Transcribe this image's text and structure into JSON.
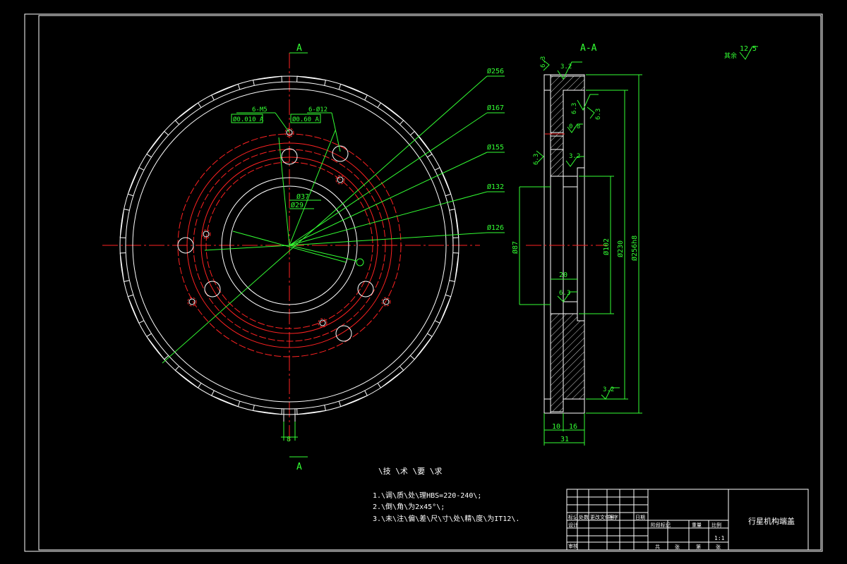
{
  "colors": {
    "background": "#000000",
    "outline": "#ffffff",
    "dimension": "#33ff33",
    "centerline": "#ff2222",
    "hidden": "#ff2222"
  },
  "drawing": {
    "section_marker_top": "A",
    "section_marker_bottom": "A",
    "section_title": "A-A",
    "hole_callout_1": "6-M5",
    "hole_callout_2": "6-Ø12",
    "tolerance_frame_1": "Ø0.010 A",
    "tolerance_frame_2": "Ø0.60 A",
    "diameter_labels": [
      "Ø256",
      "Ø167",
      "Ø155",
      "Ø132",
      "Ø126"
    ],
    "bore_label_1": "Ø37",
    "bore_label_2": "Ø29",
    "slot_width": "8",
    "section_dims": {
      "d_inner": "Ø87",
      "d_mid": "Ø102",
      "d_230": "Ø230",
      "d_outer": "Ø256h8",
      "w_20": "20",
      "w_10": "10",
      "w_16": "16",
      "w_31": "31"
    },
    "roughness": [
      "3.2",
      "6.3",
      "6.3",
      "6.3",
      "0.8",
      "3.2",
      "6.3",
      "6.3",
      "3.2"
    ],
    "general_roughness": "12.5",
    "general_roughness_prefix": "其余"
  },
  "notes": {
    "heading": "\\技 \\术 \\要 \\求",
    "items": [
      "1.\\调\\质\\处\\理HBS=220-240\\;",
      "2.\\倒\\角\\为2x45°\\;",
      "3.\\未\\注\\偏\\差\\尺\\寸\\处\\精\\度\\为IT12\\."
    ]
  },
  "title_block": {
    "part_name": "行星机构端盖",
    "scale_value": "1:1",
    "row_labels": [
      "标记",
      "处数",
      "更改文件号",
      "签字",
      "日期"
    ],
    "stage_labels": [
      "阶段标记",
      "重量",
      "比例"
    ],
    "bottom_labels": [
      "共",
      "张",
      "第",
      "张"
    ],
    "design_label": "设计",
    "check_label": "审核"
  }
}
